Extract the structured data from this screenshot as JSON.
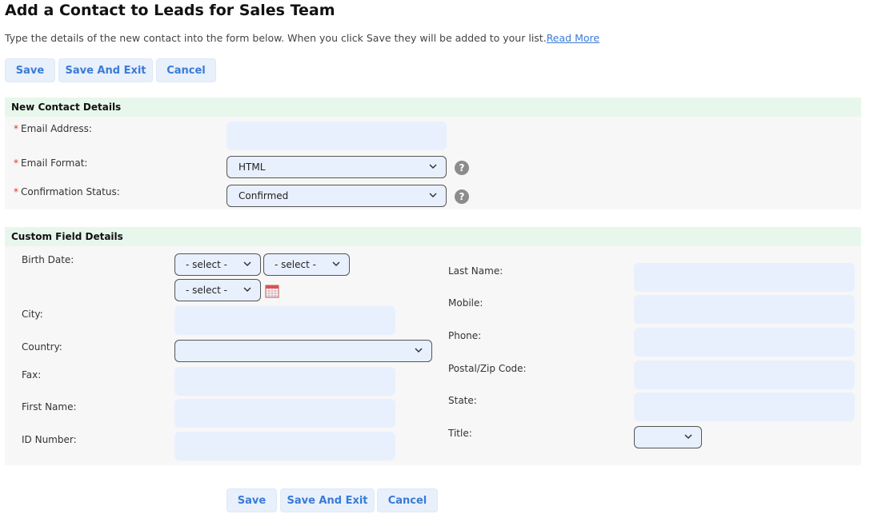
{
  "page": {
    "title": "Add a Contact to Leads for Sales Team",
    "intro": "Type the details of the new contact into the form below. When you click Save they will be added to your list.",
    "read_more": "Read More"
  },
  "toolbar": {
    "save": "Save",
    "save_exit": "Save And Exit",
    "cancel": "Cancel"
  },
  "contact": {
    "header": "New Contact Details",
    "required_mark": "*",
    "email_label": "Email Address:",
    "email_value": "",
    "format_label": "Email Format:",
    "format_value": "HTML",
    "status_label": "Confirmation Status:",
    "status_value": "Confirmed",
    "help": "?"
  },
  "custom": {
    "header": "Custom Field Details",
    "birth_label": "Birth Date:",
    "birth_day": "- select -",
    "birth_month": "- select -",
    "birth_year": "- select -",
    "city_label": "City:",
    "country_label": "Country:",
    "country_value": "",
    "fax_label": "Fax:",
    "first_name_label": "First Name:",
    "id_label": "ID Number:",
    "last_name_label": "Last Name:",
    "mobile_label": "Mobile:",
    "phone_label": "Phone:",
    "postal_label": "Postal/Zip Code:",
    "state_label": "State:",
    "title_label": "Title:",
    "title_value": ""
  },
  "icons": {
    "chevron": "chevron-down-icon",
    "help": "help-icon",
    "calendar": "calendar-icon"
  },
  "colors": {
    "accent": "#3a7bd5",
    "button_bg": "#e8f0fc",
    "section_header": "#e8f7ec",
    "section_body": "#f7f7f7",
    "input_bg": "#e8f0fe",
    "required": "#d9382b"
  }
}
